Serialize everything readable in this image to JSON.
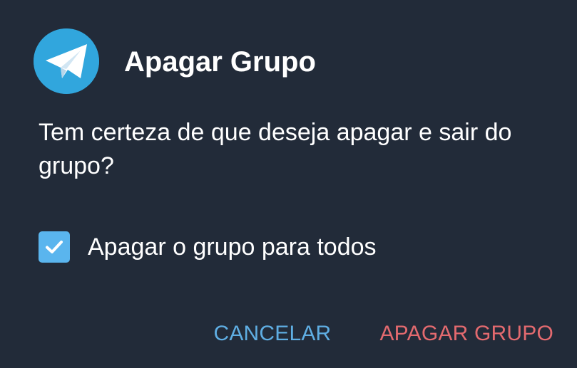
{
  "dialog": {
    "title": "Apagar Grupo",
    "message": "Tem certeza de que deseja apagar e sair do grupo?",
    "logo_icon": "telegram-logo-icon"
  },
  "option": {
    "label": "Apagar o grupo para todos",
    "checked": true,
    "icon": "check-icon"
  },
  "actions": {
    "cancel_label": "CANCELAR",
    "delete_label": "APAGAR GRUPO"
  },
  "colors": {
    "background": "#222b39",
    "accent": "#5faee3",
    "destructive": "#e36a6f",
    "checkbox": "#5ab5ee",
    "logo": "#31a6dd"
  }
}
